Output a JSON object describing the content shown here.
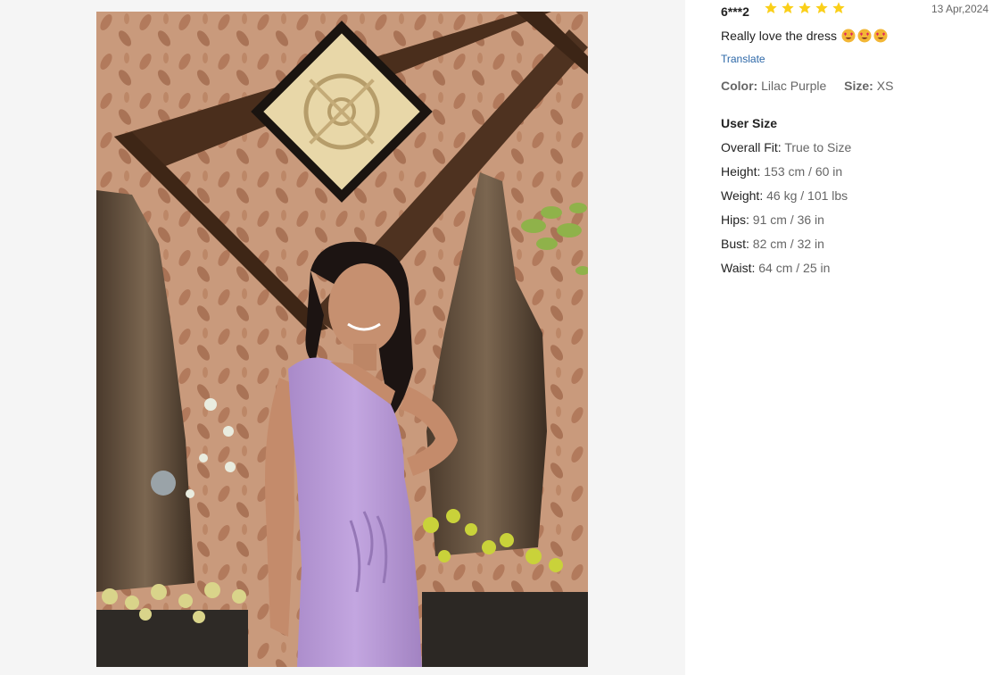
{
  "review": {
    "reviewer": "6***2",
    "rating": 5,
    "date": "13 Apr,2024",
    "text": "Really love the dress",
    "emojis": [
      "heart-eyes-emoji",
      "heart-eyes-emoji",
      "heart-eyes-emoji"
    ],
    "translate_label": "Translate",
    "color_label": "Color:",
    "color_value": "Lilac Purple",
    "size_label": "Size:",
    "size_value": "XS"
  },
  "user_size": {
    "title": "User Size",
    "items": [
      {
        "label": "Overall Fit:",
        "value": "True to Size"
      },
      {
        "label": "Height:",
        "value": "153 cm / 60 in"
      },
      {
        "label": "Weight:",
        "value": "46 kg / 101 lbs"
      },
      {
        "label": "Hips:",
        "value": "91 cm / 36 in"
      },
      {
        "label": "Bust:",
        "value": "82 cm / 32 in"
      },
      {
        "label": "Waist:",
        "value": "64 cm / 25 in"
      }
    ]
  },
  "colors": {
    "star": "#facf19",
    "link": "#2d68a8",
    "dress": "#b495d4",
    "panel_bg": "#f5f5f5"
  },
  "photo": {
    "icon": "customer-photo"
  }
}
